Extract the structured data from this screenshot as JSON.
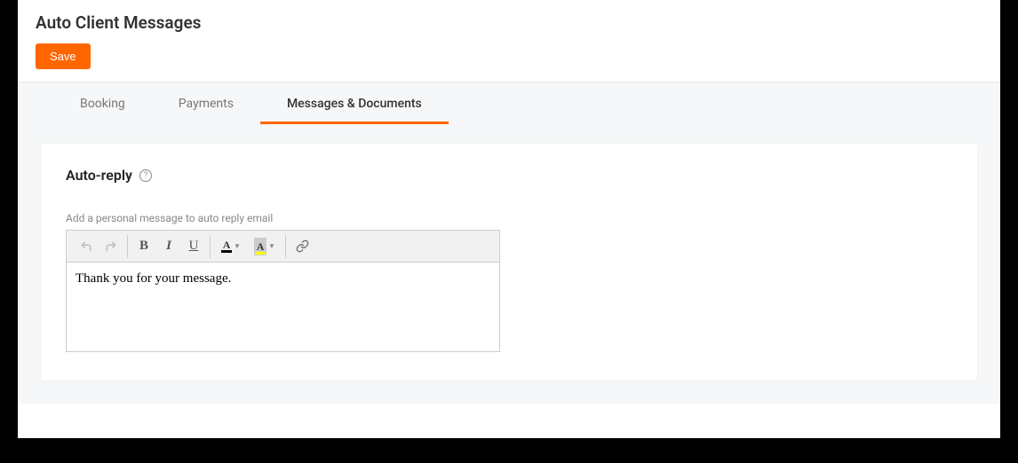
{
  "header": {
    "title": "Auto Client Messages",
    "save_label": "Save"
  },
  "tabs": [
    {
      "label": "Booking",
      "active": false
    },
    {
      "label": "Payments",
      "active": false
    },
    {
      "label": "Messages & Documents",
      "active": true
    }
  ],
  "section": {
    "title": "Auto-reply",
    "help_tooltip": "?",
    "field_label": "Add a personal message to auto reply email",
    "editor_content": "Thank you for your message."
  },
  "toolbar": {
    "undo": "undo",
    "redo": "redo",
    "bold": "B",
    "italic": "I",
    "underline_letter": "U",
    "text_color_letter": "A",
    "bg_color_letter": "A",
    "link": "link"
  },
  "colors": {
    "accent": "#ff6600",
    "text_color_underline": "#000000",
    "bg_color_underline": "#ffff00"
  }
}
